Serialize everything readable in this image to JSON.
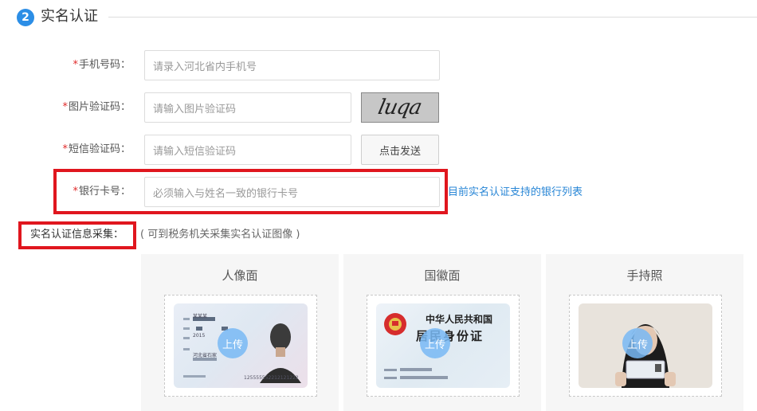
{
  "section": {
    "step": "2",
    "title": "实名认证"
  },
  "form": {
    "phone": {
      "label": "手机号码：",
      "placeholder": "请录入河北省内手机号"
    },
    "captcha": {
      "label": "图片验证码：",
      "placeholder": "请输入图片验证码",
      "image_text": "luqa"
    },
    "sms": {
      "label": "短信验证码：",
      "placeholder": "请输入短信验证码",
      "send_button": "点击发送"
    },
    "bank": {
      "label": "银行卡号：",
      "placeholder": "必须输入与姓名一致的银行卡号",
      "link": "目前实名认证支持的银行列表"
    },
    "required_mark": "*"
  },
  "collect": {
    "label": "实名认证信息采集：",
    "note": "( 可到税务机关采集实名认证图像 )"
  },
  "panels": [
    {
      "title": "人像面",
      "upload": "上传",
      "card_name": "某某某",
      "card_year": "2015",
      "card_address": "河北省石家",
      "card_number": "125555552212121222"
    },
    {
      "title": "国徽面",
      "upload": "上传",
      "card_line1": "中华人民共和国",
      "card_line2": "居民身份证"
    },
    {
      "title": "手持照",
      "upload": "上传"
    }
  ],
  "colors": {
    "accent": "#2c8ee6",
    "highlight": "#e0161e",
    "link": "#2886d6",
    "required": "#e02a2a"
  }
}
